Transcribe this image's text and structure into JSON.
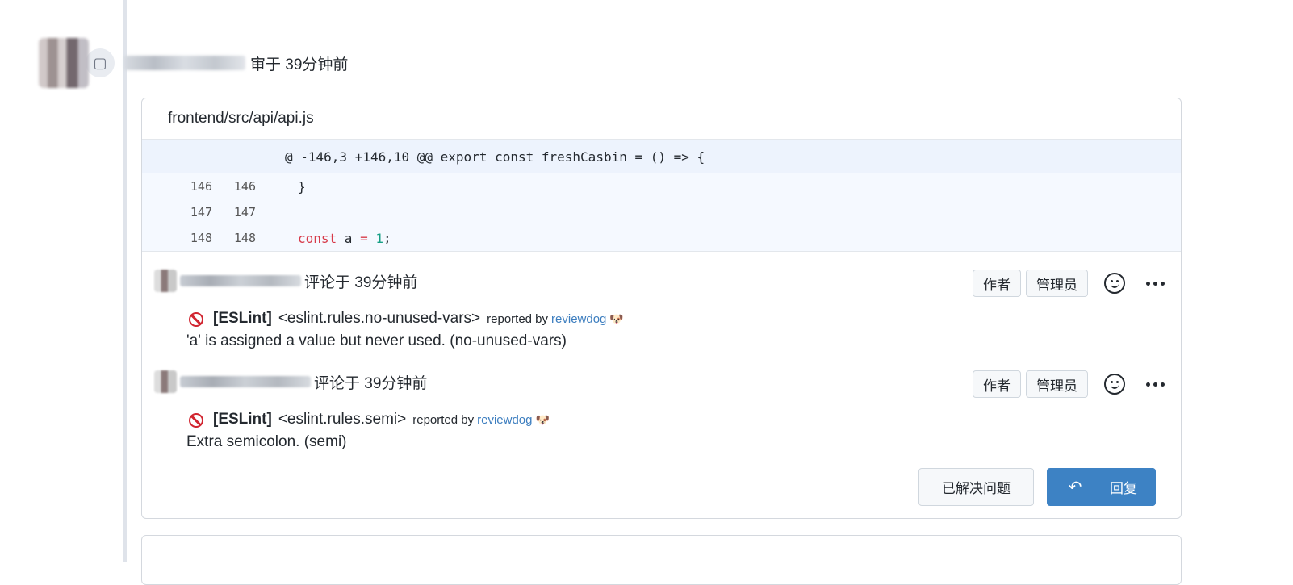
{
  "review": {
    "meta": "审于 39分钟前",
    "file_path": "frontend/src/api/api.js",
    "hunk": "@ -146,3 +146,10 @@ export const freshCasbin = () => {",
    "code_lines": [
      {
        "old": "146",
        "new": "146",
        "text": "}"
      },
      {
        "old": "147",
        "new": "147",
        "text": ""
      },
      {
        "old": "148",
        "new": "148",
        "kw": "const",
        "var": " a ",
        "op": "=",
        "num": "1",
        "end": ";"
      }
    ]
  },
  "comments": [
    {
      "meta": "评论于 39分钟前",
      "tag_author": "作者",
      "tag_admin": "管理员",
      "linter": "[ESLint]",
      "rule": "<eslint.rules.no-unused-vars>",
      "reported_by": "reported by",
      "reporter": "reviewdog",
      "reporter_emoji": "🐶",
      "message": "'a' is assigned a value but never used. (no-unused-vars)"
    },
    {
      "meta": "评论于 39分钟前",
      "tag_author": "作者",
      "tag_admin": "管理员",
      "linter": "[ESLint]",
      "rule": "<eslint.rules.semi>",
      "reported_by": "reported by",
      "reporter": "reviewdog",
      "reporter_emoji": "🐶",
      "message": "Extra semicolon. (semi)"
    }
  ],
  "actions": {
    "resolve_label": "已解决问题",
    "reply_label": "回复",
    "reply_icon": "↶"
  },
  "icons": {
    "reply": "reply-arrow-icon",
    "reaction": "smiley-icon",
    "more": "ellipsis-icon",
    "error": "ban-icon"
  },
  "colors": {
    "link": "#3d7ebf",
    "primary_button": "#3d82c4",
    "error": "#d1242f",
    "code_bg": "#f5f9ff"
  }
}
